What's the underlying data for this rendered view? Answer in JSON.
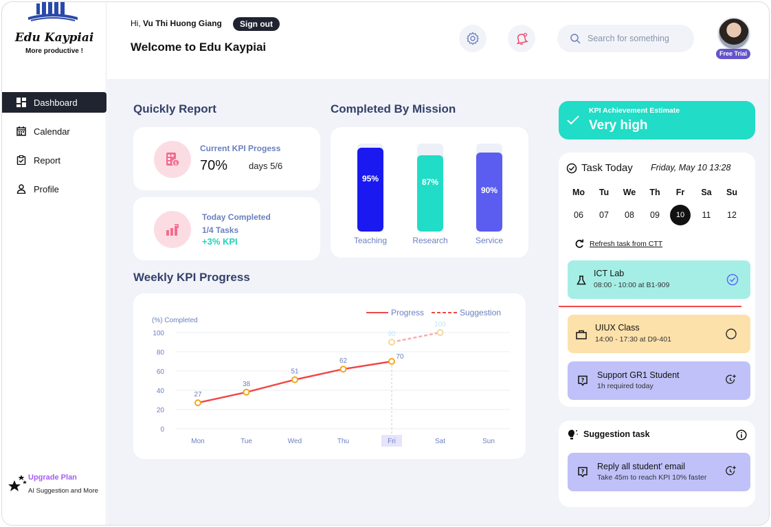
{
  "app": {
    "brand": "Edu Kaypiai",
    "tagline": "More productive !"
  },
  "sidebar": {
    "items": [
      {
        "label": "Dashboard",
        "icon": "dashboard-icon",
        "active": true
      },
      {
        "label": "Calendar",
        "icon": "calendar-icon",
        "active": false
      },
      {
        "label": "Report",
        "icon": "report-icon",
        "active": false
      },
      {
        "label": "Profile",
        "icon": "profile-icon",
        "active": false
      }
    ],
    "upgrade": {
      "title": "Upgrade Plan",
      "subtitle": "AI Suggestion and More"
    }
  },
  "header": {
    "greeting_prefix": "Hi, ",
    "user_name": "Vu Thi Huong Giang",
    "sign_out": "Sign out",
    "welcome": "Welcome to Edu Kaypiai",
    "search_placeholder": "Search for something",
    "plan_badge": "Free Trial"
  },
  "quick_report": {
    "title": "Quickly Report",
    "kpi_progress": {
      "label": "Current KPI Progess",
      "value": "70%",
      "days": "days 5/6"
    },
    "today_completed": {
      "label": "Today Completed",
      "tasks": "1/4 Tasks",
      "kpi_delta": "+3% KPI"
    }
  },
  "completed_by_mission": {
    "title": "Completed By Mission",
    "chart_data": {
      "type": "bar",
      "categories": [
        "Teaching",
        "Research",
        "Service"
      ],
      "values": [
        95,
        87,
        90
      ],
      "value_labels": [
        "95%",
        "87%",
        "90%"
      ],
      "colors": [
        "#1919f0",
        "#21dcc6",
        "#5b5cf0"
      ],
      "ylim": [
        0,
        100
      ]
    }
  },
  "weekly_kpi": {
    "title": "Weekly KPI Progress",
    "chart_data": {
      "type": "line",
      "categories": [
        "Mon",
        "Tue",
        "Wed",
        "Thu",
        "Fri",
        "Sat",
        "Sun"
      ],
      "ylabel": "(%) Completed",
      "ylim": [
        0,
        100
      ],
      "yticks": [
        0,
        20,
        40,
        60,
        80,
        100
      ],
      "highlight_category": "Fri",
      "series": [
        {
          "name": "Progress",
          "values": [
            27,
            38,
            51,
            62,
            70,
            null,
            null
          ],
          "color": "#ef4747",
          "style": "solid"
        },
        {
          "name": "Suggestion",
          "values": [
            null,
            null,
            null,
            null,
            90,
            100,
            null
          ],
          "color": "#ef4747",
          "style": "dashed"
        }
      ],
      "point_labels": [
        "27",
        "38",
        "51",
        "62",
        "70",
        "90",
        "100"
      ],
      "legend_position": "top-right"
    }
  },
  "kpi_estimate": {
    "label": "KPI Achievement Estimate",
    "value": "Very high"
  },
  "task_today": {
    "title": "Task Today",
    "date": "Friday, May 10 13:28",
    "weekdays": [
      "Mo",
      "Tu",
      "We",
      "Th",
      "Fr",
      "Sa",
      "Su"
    ],
    "days": [
      "06",
      "07",
      "08",
      "09",
      "10",
      "11",
      "12"
    ],
    "today": "10",
    "refresh": "Refresh task from CTT",
    "tasks": [
      {
        "title": "ICT Lab",
        "sub": "08:00 - 10:00 at B1-909",
        "status": "done",
        "color": "#a5eee6"
      },
      {
        "title": "UIUX Class",
        "sub": "14:00 - 17:30 at D9-401",
        "status": "pending",
        "color": "#fde1aa"
      },
      {
        "title": "Support GR1 Student",
        "sub": "1h required today",
        "status": "schedule",
        "color": "#bfc1f8"
      }
    ]
  },
  "suggestion": {
    "title": "Suggestion task",
    "task": {
      "title": "Reply all student’ email",
      "sub": "Take 45m to reach KPI 10% faster"
    }
  }
}
